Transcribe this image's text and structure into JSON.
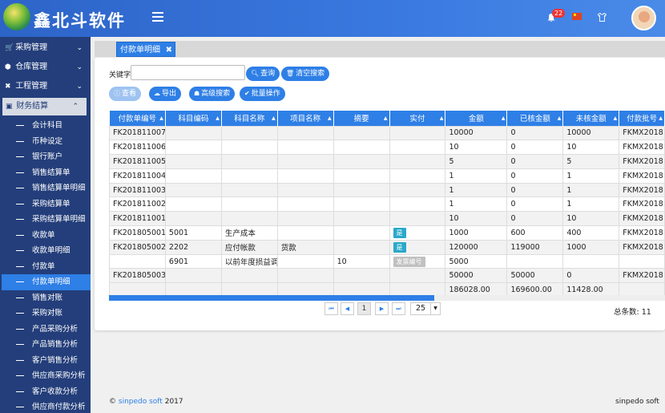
{
  "app": {
    "logo_text": "鑫北斗软件"
  },
  "header": {
    "notification_count": "22"
  },
  "sidebar": {
    "groups": [
      {
        "label": "采购管理",
        "icon": "cart-icon"
      },
      {
        "label": "仓库管理",
        "icon": "cube-icon"
      },
      {
        "label": "工程管理",
        "icon": "wrench-icon"
      },
      {
        "label": "财务结算",
        "icon": "wallet-icon"
      }
    ],
    "items": [
      "会计科目",
      "币种设定",
      "银行账户",
      "销售结算单",
      "销售结算单明细",
      "采购结算单",
      "采购结算单明细",
      "收款单",
      "收款单明细",
      "付款单",
      "付款单明细",
      "销售对账",
      "采购对账",
      "产品采购分析",
      "产品销售分析",
      "客户销售分析",
      "供应商采购分析",
      "客户收款分析",
      "供应商付款分析"
    ],
    "active_item": "付款单明细"
  },
  "tabs": [
    {
      "label": "付款单明细"
    }
  ],
  "search": {
    "label": "关键字",
    "value": "",
    "query_btn": "查询",
    "clear_btn": "清空搜索"
  },
  "toolbar": {
    "view_btn": "查看",
    "export_btn": "导出",
    "advanced_btn": "高级搜索",
    "batch_btn": "批量操作"
  },
  "table": {
    "headers": [
      "付款单编号",
      "科目编码",
      "科目名称",
      "项目名称",
      "摘要",
      "实付",
      "金额",
      "已核金额",
      "未核金额",
      "付款批号"
    ],
    "rows": [
      [
        "FK201811007",
        "",
        "",
        "",
        "",
        "",
        "10000",
        "0",
        "10000",
        "FKMX2018"
      ],
      [
        "FK201811006",
        "",
        "",
        "",
        "",
        "",
        "10",
        "0",
        "10",
        "FKMX2018"
      ],
      [
        "FK201811005",
        "",
        "",
        "",
        "",
        "",
        "5",
        "0",
        "5",
        "FKMX2018"
      ],
      [
        "FK201811004",
        "",
        "",
        "",
        "",
        "",
        "1",
        "0",
        "1",
        "FKMX2018"
      ],
      [
        "FK201811003",
        "",
        "",
        "",
        "",
        "",
        "1",
        "0",
        "1",
        "FKMX2018"
      ],
      [
        "FK201811002",
        "",
        "",
        "",
        "",
        "",
        "1",
        "0",
        "1",
        "FKMX2018"
      ],
      [
        "FK201811001",
        "",
        "",
        "",
        "",
        "",
        "10",
        "0",
        "10",
        "FKMX2018"
      ],
      [
        "FK201805001",
        "5001",
        "生产成本",
        "",
        "",
        "是",
        "1000",
        "600",
        "400",
        "FKMX2018"
      ],
      [
        "FK201805002",
        "2202",
        "应付帐款",
        "货款",
        "",
        "是",
        "120000",
        "119000",
        "1000",
        "FKMX2018"
      ],
      [
        "",
        "6901",
        "以前年度损益调",
        "",
        "10",
        "发票编号",
        "5000",
        "",
        "",
        ""
      ],
      [
        "FK201805003",
        "",
        "",
        "",
        "",
        "",
        "50000",
        "50000",
        "0",
        "FKMX2018"
      ]
    ],
    "summary": [
      "",
      "",
      "",
      "",
      "",
      "",
      "186028.00",
      "169600.00",
      "11428.00",
      ""
    ]
  },
  "pager": {
    "first": "⏮",
    "prev": "◀",
    "current": "1",
    "next": "▶",
    "last": "⏭",
    "page_size": "25",
    "total_label": "总条数: 11"
  },
  "footer": {
    "copyright_prefix": "©",
    "copyright_link": "sinpedo soft",
    "copyright_year": "2017",
    "brand": "sinpedo soft"
  }
}
